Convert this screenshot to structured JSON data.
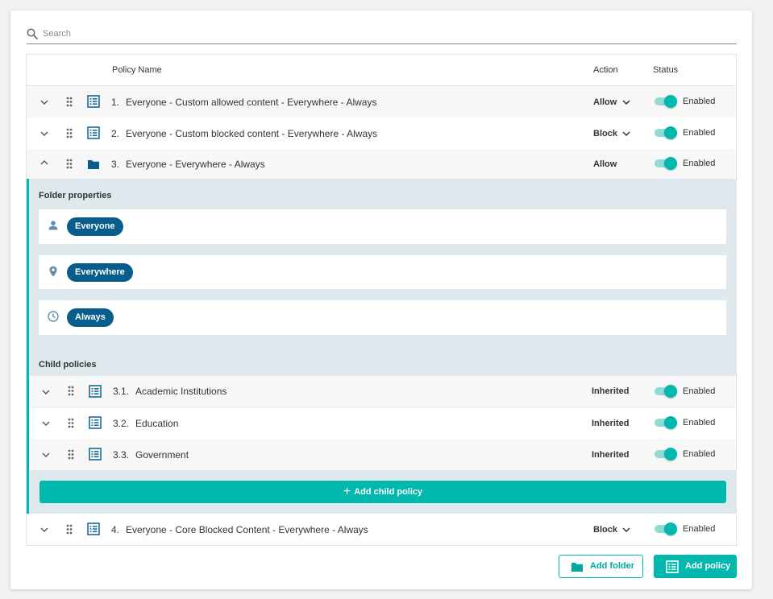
{
  "search": {
    "placeholder": "Search"
  },
  "columns": {
    "policy_name": "Policy Name",
    "action": "Action",
    "status": "Status"
  },
  "policies": [
    {
      "number": "1.",
      "name": "Everyone - Custom allowed content - Everywhere - Always",
      "action": "Allow",
      "status": "Enabled",
      "icon": "list-icon"
    },
    {
      "number": "2.",
      "name": "Everyone - Custom blocked content - Everywhere - Always",
      "action": "Block",
      "status": "Enabled",
      "icon": "list-icon"
    },
    {
      "number": "3.",
      "name": "Everyone - Everywhere - Always",
      "action": "Allow",
      "status": "Enabled",
      "icon": "folder-icon"
    },
    {
      "number": "4.",
      "name": "Everyone - Core Blocked Content - Everywhere - Always",
      "action": "Block",
      "status": "Enabled",
      "icon": "list-icon"
    }
  ],
  "folder_properties": {
    "title": "Folder properties",
    "items": [
      {
        "icon": "person-icon",
        "label": "Everyone"
      },
      {
        "icon": "location-pin-icon",
        "label": "Everywhere"
      },
      {
        "icon": "clock-icon",
        "label": "Always"
      }
    ]
  },
  "child_policies": {
    "title": "Child policies",
    "items": [
      {
        "number": "3.1.",
        "name": "Academic Institutions",
        "action": "Inherited",
        "status": "Enabled"
      },
      {
        "number": "3.2.",
        "name": "Education",
        "action": "Inherited",
        "status": "Enabled"
      },
      {
        "number": "3.3.",
        "name": "Government",
        "action": "Inherited",
        "status": "Enabled"
      }
    ],
    "add_label": "Add child policy"
  },
  "buttons": {
    "add_folder": "Add folder",
    "add_policy": "Add policy"
  },
  "colors": {
    "accent": "#00b8ad",
    "chip": "#075e8d",
    "icon_blue": "#1b6a9c",
    "expanded_bg": "#dfe9ed"
  }
}
